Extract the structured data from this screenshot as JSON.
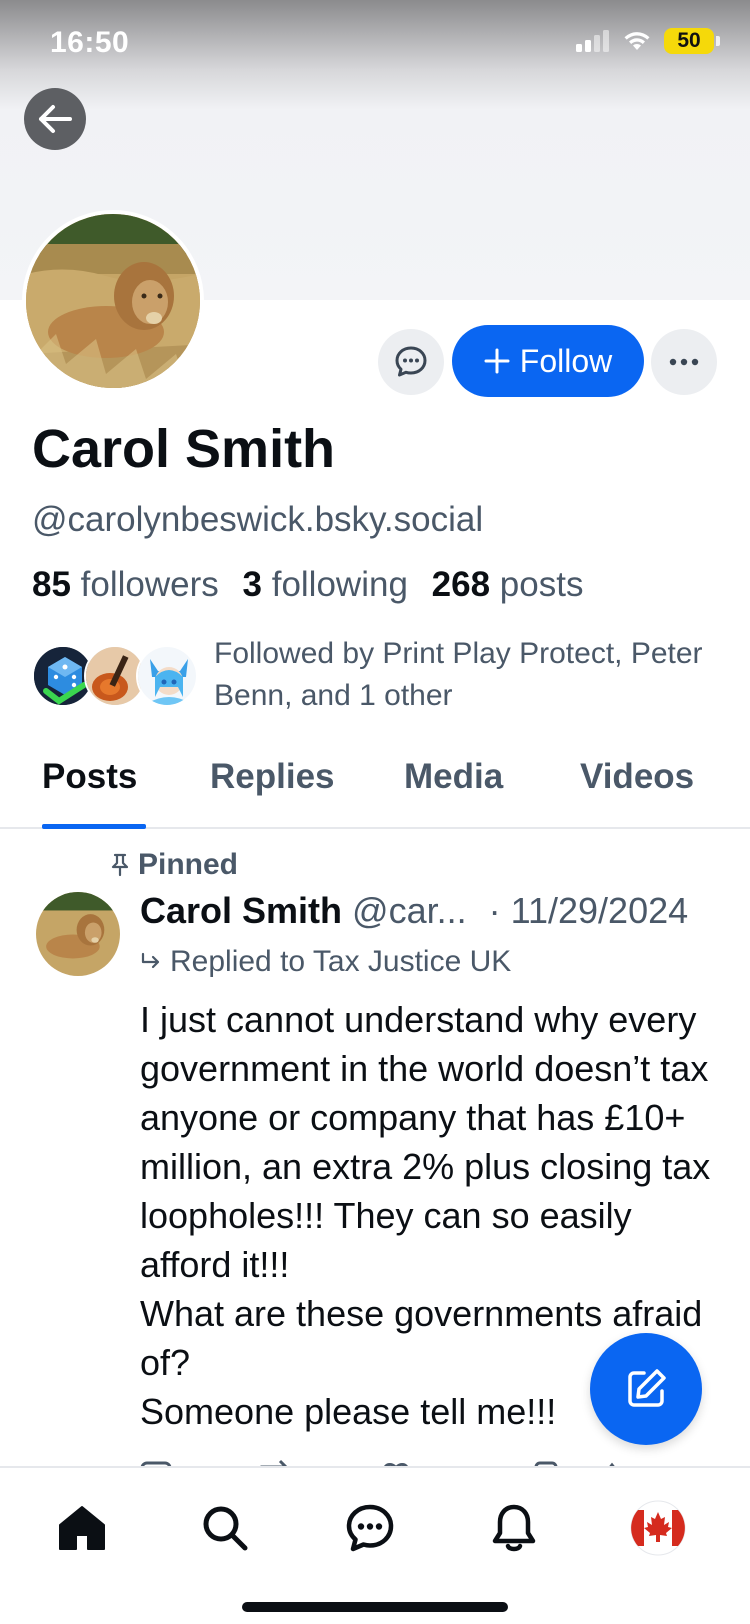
{
  "status_bar": {
    "time": "16:50",
    "battery": "50"
  },
  "profile": {
    "display_name": "Carol Smith",
    "handle": "@carolynbeswick.bsky.social",
    "followers_count": "85",
    "followers_label": "followers",
    "following_count": "3",
    "following_label": "following",
    "posts_count": "268",
    "posts_label": "posts",
    "follow_button_label": "Follow",
    "followed_by_text": "Followed by Print Play Protect, Peter Benn, and 1 other"
  },
  "tabs": [
    {
      "label": "Posts",
      "active": true
    },
    {
      "label": "Replies",
      "active": false
    },
    {
      "label": "Media",
      "active": false
    },
    {
      "label": "Videos",
      "active": false
    }
  ],
  "pinned_post": {
    "pinned_label": "Pinned",
    "author_name": "Carol Smith",
    "author_handle": "@car...",
    "date": "· 11/29/2024",
    "replied_to": "Replied to Tax Justice UK",
    "text_lines": [
      "I just cannot understand why every government in the world doesn’t tax anyone or company that has £10+ million, an extra 2% plus closing tax loopholes!!! They can so easily afford it!!!",
      "What are these governments afraid of?",
      "Someone please tell me!!!"
    ]
  },
  "bottom_nav": [
    {
      "name": "home",
      "icon": "home-icon"
    },
    {
      "name": "search",
      "icon": "search-icon"
    },
    {
      "name": "chat",
      "icon": "chat-icon"
    },
    {
      "name": "notifications",
      "icon": "bell-icon"
    },
    {
      "name": "profile",
      "icon": "avatar-canada-flag"
    }
  ],
  "colors": {
    "accent": "#0a66f2",
    "text_primary": "#0b0f14",
    "text_secondary": "#4a5868"
  }
}
